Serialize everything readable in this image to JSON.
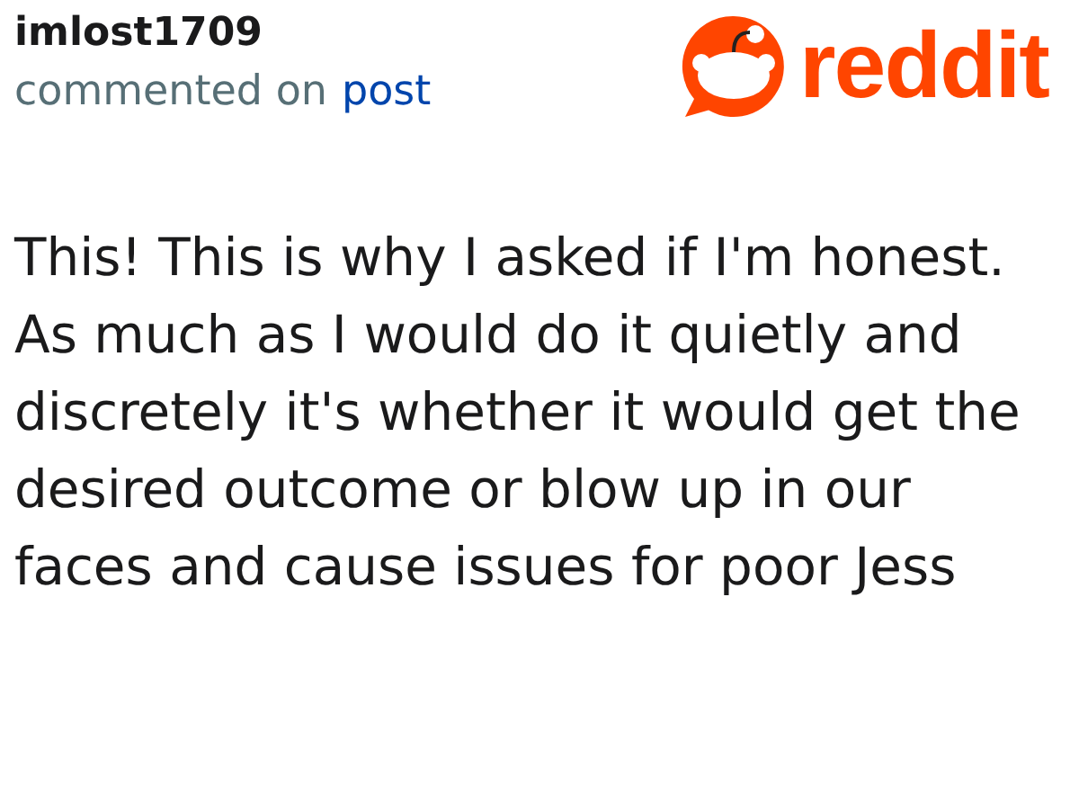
{
  "comment": {
    "author": "imlost1709",
    "action": "commented on",
    "link": "post",
    "body": "This! This is why I asked if I'm honest. As much as I would do it quietly and discretely it's whether it would get the desired outcome or blow up in our faces and cause issues for poor Jess"
  },
  "logo": {
    "text": "reddit"
  }
}
